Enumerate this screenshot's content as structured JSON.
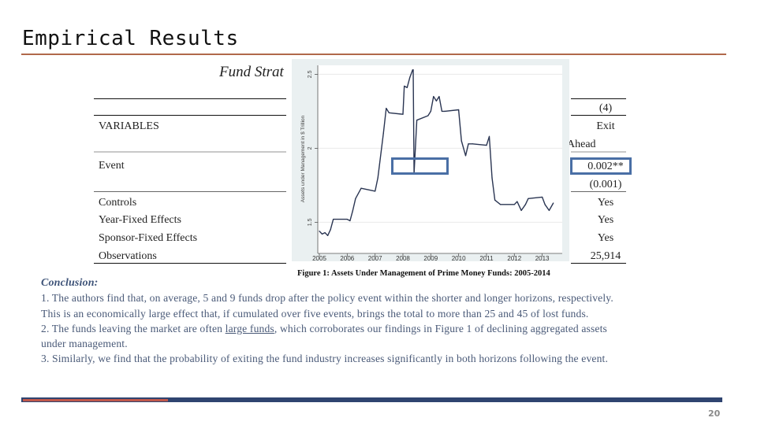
{
  "slide": {
    "title": "Empirical Results",
    "page_number": "20",
    "colors": {
      "title_rule": "#b0684a",
      "footer_primary": "#2f4470",
      "footer_accent": "#c0584a",
      "highlight": "#4a6fa5",
      "conclusion_text": "#4a5a78"
    }
  },
  "table": {
    "heading": "Fund Strat",
    "column_number": "(4)",
    "column_label_1": "Exit",
    "column_label_2": "Ahead",
    "rows": [
      {
        "label": "VARIABLES",
        "value": ""
      },
      {
        "label": "Event",
        "value": "0.002**",
        "se": "(0.001)"
      },
      {
        "label": "Controls",
        "value": "Yes"
      },
      {
        "label": "Year-Fixed Effects",
        "value": "Yes"
      },
      {
        "label": "Sponsor-Fixed Effects",
        "value": "Yes"
      },
      {
        "label": "Observations",
        "value": "25,914"
      }
    ]
  },
  "chart_data": {
    "type": "line",
    "title": "Figure 1: Assets Under Management of Prime Money Funds: 2005-2014",
    "xlabel": "",
    "ylabel": "Assets under Management in $ Trillion",
    "xlim": [
      2005,
      2013.6
    ],
    "ylim": [
      1.3,
      2.55
    ],
    "xticks": [
      "2005",
      "2006",
      "2007",
      "2008",
      "2009",
      "2010",
      "2011",
      "2012",
      "2013"
    ],
    "yticks": [
      "1.5",
      "2",
      "2.5"
    ],
    "grid": true,
    "series": [
      {
        "name": "AUM",
        "x": [
          2005.0,
          2005.1,
          2005.2,
          2005.3,
          2005.4,
          2005.5,
          2006.0,
          2006.1,
          2006.2,
          2006.3,
          2006.5,
          2007.0,
          2007.1,
          2007.3,
          2007.4,
          2007.5,
          2008.0,
          2008.05,
          2008.15,
          2008.25,
          2008.35,
          2008.37,
          2008.4,
          2008.5,
          2008.9,
          2009.0,
          2009.1,
          2009.2,
          2009.3,
          2009.4,
          2009.5,
          2010.0,
          2010.1,
          2010.25,
          2010.35,
          2010.5,
          2011.0,
          2011.1,
          2011.2,
          2011.3,
          2011.5,
          2012.0,
          2012.1,
          2012.25,
          2012.4,
          2012.5,
          2013.0,
          2013.1,
          2013.25,
          2013.4
        ],
        "y": [
          1.44,
          1.42,
          1.43,
          1.41,
          1.45,
          1.52,
          1.52,
          1.51,
          1.58,
          1.66,
          1.73,
          1.71,
          1.8,
          2.1,
          2.27,
          2.24,
          2.23,
          2.42,
          2.41,
          2.48,
          2.53,
          2.53,
          1.83,
          2.19,
          2.22,
          2.25,
          2.35,
          2.32,
          2.35,
          2.25,
          2.25,
          2.26,
          2.05,
          1.95,
          2.03,
          2.03,
          2.02,
          2.08,
          1.8,
          1.65,
          1.62,
          1.62,
          1.64,
          1.58,
          1.62,
          1.66,
          1.67,
          1.62,
          1.58,
          1.63
        ]
      }
    ],
    "highlight": "2008 drop region (around 2008.4, ~1.8-1.9 trillion)"
  },
  "conclusion": {
    "heading": "Conclusion:",
    "line1": "1. The authors find that, on average, 5 and 9 funds drop after the policy event within the shorter and longer horizons, respectively.",
    "line2": "This is an economically large effect that, if cumulated over five events, brings the total to more than 25 and 45 of lost funds.",
    "line3_pre": "2. The funds leaving the market are often ",
    "line3_ul": "large funds",
    "line3_post": ", which corroborates our findings in Figure 1 of declining aggregated assets",
    "line4": "under management.",
    "line5": "3. Similarly, we find that the probability of exiting the fund industry increases significantly in both horizons following the event."
  }
}
